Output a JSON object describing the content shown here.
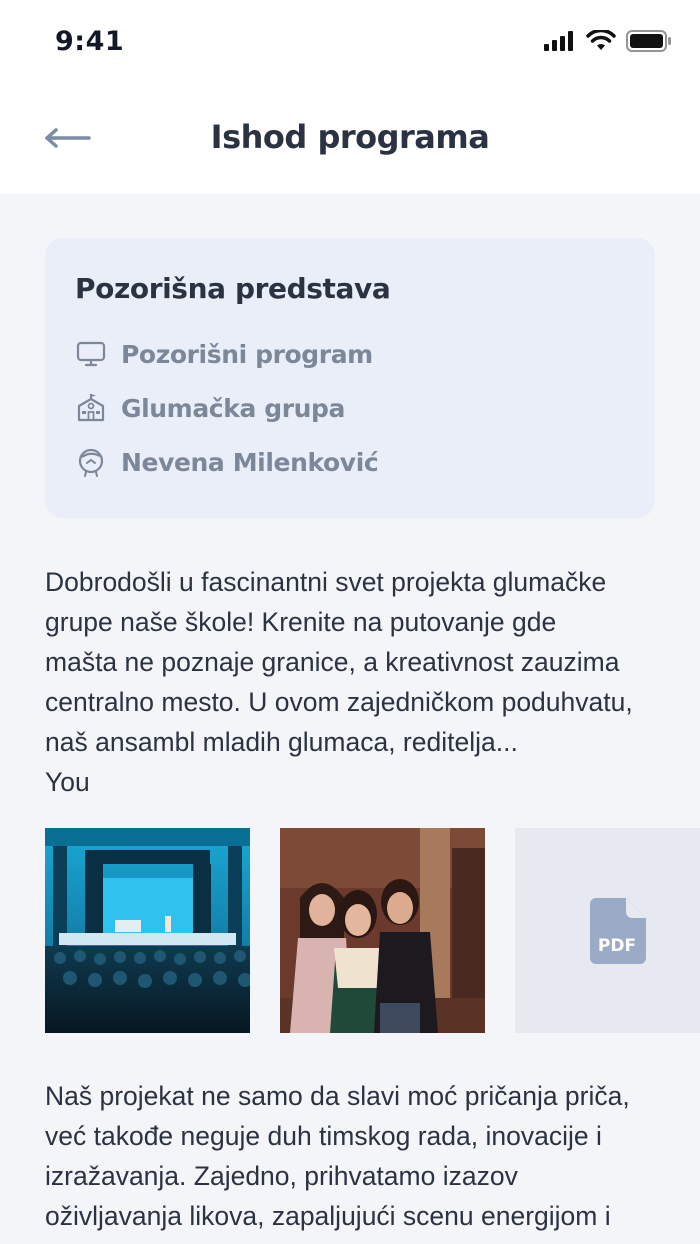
{
  "status_bar": {
    "time": "9:41"
  },
  "header": {
    "title": "Ishod programa",
    "back_icon": "arrow-left-icon"
  },
  "card": {
    "title": "Pozorišna predstava",
    "items": [
      {
        "icon": "monitor-icon",
        "label": "Pozorišni program"
      },
      {
        "icon": "school-building-icon",
        "label": "Glumačka grupa"
      },
      {
        "icon": "teacher-face-icon",
        "label": "Nevena Milenković"
      }
    ]
  },
  "description": {
    "lines": [
      "Dobrodošli u fascinantni svet projekta glumačke",
      "grupe naše škole! Krenite na putovanje gde",
      "mašta ne poznaje granice, a kreativnost zauzima",
      "centralno mesto. U ovom zajedničkom poduhvatu,",
      "naš ansambl mladih glumaca, reditelja..."
    ],
    "more": "You"
  },
  "attachments": {
    "pdf_label": "PDF"
  },
  "description_2": {
    "lines": [
      "Naš projekat ne samo da slavi moć pričanja priča,",
      "već takođe neguje duh timskog rada, inovacije i",
      "izražavanja. Zajedno, prihvatamo izazov",
      "oživljavanja likova, zapaljujući scenu energijom i"
    ]
  },
  "colors": {
    "accent": "#7b8aa6",
    "card_bg": "#e9eef8",
    "page_bg": "#f3f5f9",
    "muted_text": "#7c8799"
  }
}
